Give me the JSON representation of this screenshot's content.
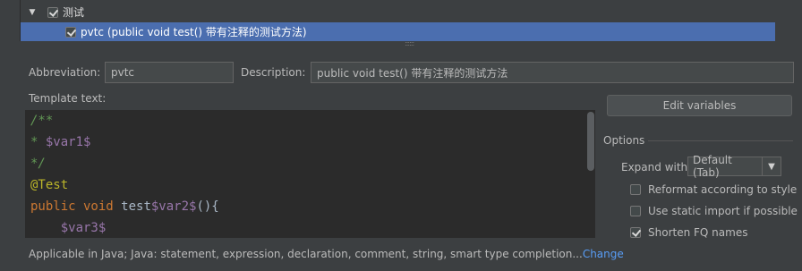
{
  "tree": {
    "group": {
      "label": "测试",
      "checked": true
    },
    "item": {
      "label": "pvtc (public void test() 带有注释的测试方法)",
      "checked": true
    }
  },
  "abbreviation": {
    "label": "Abbreviation:",
    "value": "pvtc"
  },
  "description": {
    "label": "Description:",
    "value": "public void test() 带有注释的测试方法"
  },
  "template": {
    "label": "Template text:",
    "lines": [
      "/**",
      "* $var1$",
      "*/",
      "@Test",
      "public void test$var2$(){",
      "    $var3$"
    ]
  },
  "buttons": {
    "edit_variables": "Edit variables"
  },
  "options": {
    "title": "Options",
    "expand_label": "Expand with",
    "expand_value": "Default (Tab)",
    "reformat": {
      "label": "Reformat according to style",
      "checked": false
    },
    "static_import": {
      "label": "Use static import if possible",
      "checked": false
    },
    "shorten_fq": {
      "label": "Shorten FQ names",
      "checked": true
    }
  },
  "footer": {
    "applicable": "Applicable in Java; Java: statement, expression, declaration, comment, string, smart type completion...",
    "change_link": "Change"
  },
  "colors": {
    "selection": "#4b6eaf",
    "keyword": "#cc7832",
    "comment": "#629755",
    "variable": "#9876aa",
    "link": "#589df6"
  }
}
